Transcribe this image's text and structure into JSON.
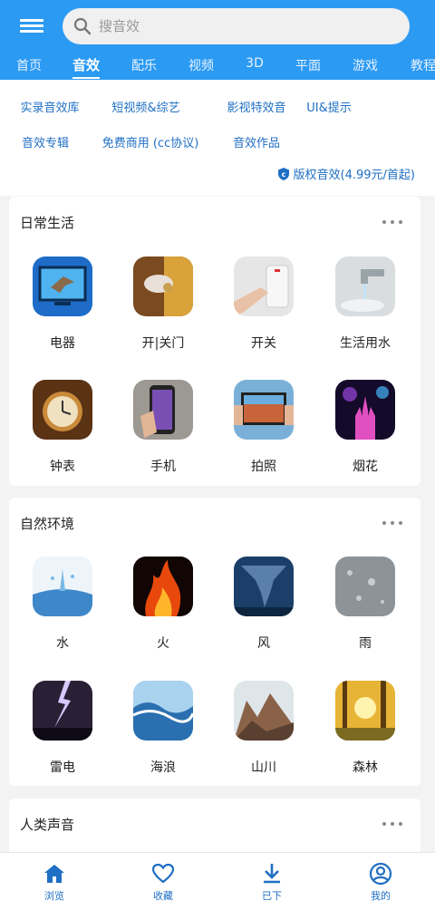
{
  "header": {
    "search_placeholder": "搜音效",
    "tabs": [
      "首页",
      "音效",
      "配乐",
      "视频",
      "3D",
      "平面",
      "游戏",
      "教程"
    ],
    "active_tab": "音效",
    "accent": "#2b9af3"
  },
  "subcats": [
    "实录音效库",
    "短视频&综艺",
    "影视特效音",
    "UI&提示",
    "音效专辑",
    "免费商用 (cc协议)",
    "音效作品"
  ],
  "copyright": "版权音效(4.99元/首起)",
  "sections": [
    {
      "title": "日常生活",
      "items": [
        "电器",
        "开|关门",
        "开关",
        "生活用水",
        "钟表",
        "手机",
        "拍照",
        "烟花"
      ]
    },
    {
      "title": "自然环境",
      "items": [
        "水",
        "火",
        "风",
        "雨",
        "雷电",
        "海浪",
        "山川",
        "森林"
      ]
    },
    {
      "title": "人类声音",
      "items": []
    }
  ],
  "nav": [
    "浏览",
    "收藏",
    "已下",
    "我的"
  ]
}
